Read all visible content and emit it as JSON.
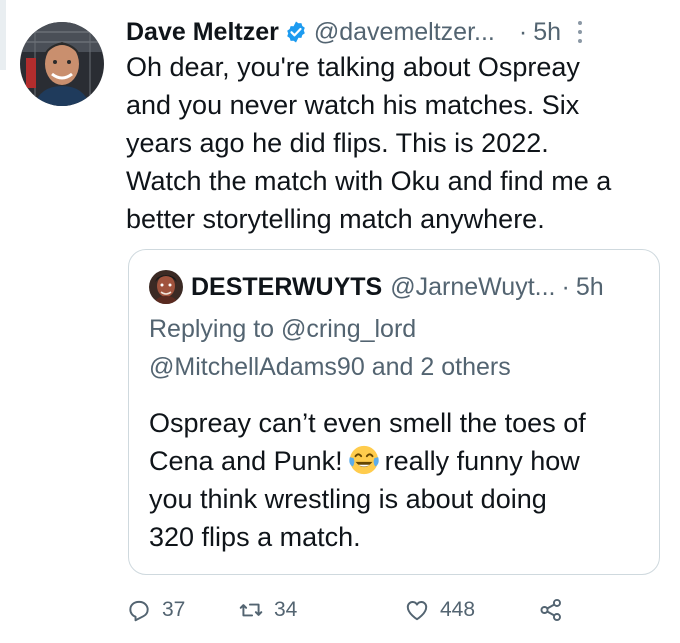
{
  "tweet": {
    "author_name": "Dave Meltzer",
    "author_handle": "@davemeltzer...",
    "separator": "·",
    "time": "5h",
    "text_lines": [
      "Oh dear, you're talking about Ospreay",
      "and you never watch his matches.  Six",
      "years ago he did flips.  This is 2022.",
      "Watch the match with Oku and find me a",
      "better storytelling match anywhere."
    ],
    "icons": {
      "verified": "verified-badge-icon",
      "more": "more-options-icon"
    },
    "colors": {
      "verified": "#1d9bf0",
      "muted": "#536471",
      "border": "#cfd9de"
    }
  },
  "quote": {
    "author_name": "DESTERWUYTS",
    "author_handle": "@JarneWuyt...",
    "separator": "·",
    "time": "5h",
    "reply_prefix": "Replying to",
    "reply_mention_1": "@cring_lord",
    "reply_mention_2": "@MitchellAdams90",
    "reply_and": "and",
    "reply_others": "2 others",
    "text_line_1": "Ospreay can’t even smell the toes of",
    "text_line_2_before": "Cena and Punk!",
    "text_line_2_after": "really funny how",
    "text_line_3": "you think wrestling is about doing",
    "text_line_4": "320 flips a match.",
    "emoji": "face-with-tears-of-joy-emoji"
  },
  "actions": {
    "reply_count": "37",
    "retweet_count": "34",
    "like_count": "448",
    "icons": [
      "reply-icon",
      "retweet-icon",
      "like-icon",
      "share-icon"
    ]
  }
}
